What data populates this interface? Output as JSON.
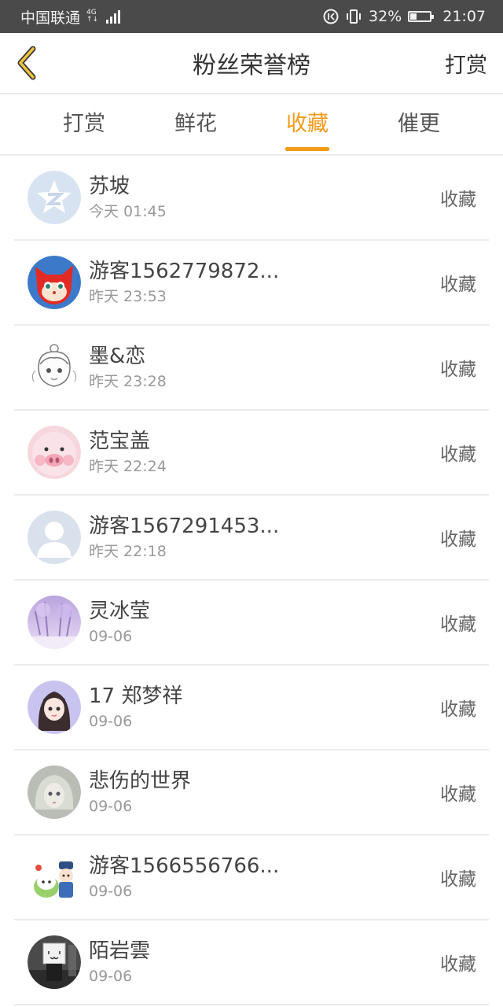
{
  "status_bar": {
    "carrier": "中国联通",
    "network": "4G",
    "battery": "32%",
    "battery_level": 0.32,
    "time": "21:07"
  },
  "header": {
    "title": "粉丝荣誉榜",
    "right_action": "打赏"
  },
  "tabs": [
    {
      "label": "打赏",
      "active": false
    },
    {
      "label": "鲜花",
      "active": false
    },
    {
      "label": "收藏",
      "active": true
    },
    {
      "label": "催更",
      "active": false
    }
  ],
  "colors": {
    "accent": "#f39a1b",
    "status_bar_bg": "#4a4a4a"
  },
  "fans": [
    {
      "name": "苏坡",
      "time": "今天 01:45",
      "action": "收藏",
      "avatar": "qq-logo-icon"
    },
    {
      "name": "游客1562779872...",
      "time": "昨天 23:53",
      "action": "收藏",
      "avatar": "red-fox-avatar"
    },
    {
      "name": "墨&恋",
      "time": "昨天 23:28",
      "action": "收藏",
      "avatar": "sketch-girl-avatar"
    },
    {
      "name": "范宝盖",
      "time": "昨天 22:24",
      "action": "收藏",
      "avatar": "pig-avatar"
    },
    {
      "name": "游客1567291453...",
      "time": "昨天 22:18",
      "action": "收藏",
      "avatar": "default-user-icon"
    },
    {
      "name": "灵冰莹",
      "time": "09-06",
      "action": "收藏",
      "avatar": "purple-forest-avatar"
    },
    {
      "name": "17 郑梦祥",
      "time": "09-06",
      "action": "收藏",
      "avatar": "anime-girl-avatar"
    },
    {
      "name": "悲伤的世界",
      "time": "09-06",
      "action": "收藏",
      "avatar": "doll-avatar"
    },
    {
      "name": "游客1566556766...",
      "time": "09-06",
      "action": "收藏",
      "avatar": "cartoon-couple-avatar"
    },
    {
      "name": "陌岩雲",
      "time": "09-06",
      "action": "收藏",
      "avatar": "box-head-avatar"
    }
  ]
}
